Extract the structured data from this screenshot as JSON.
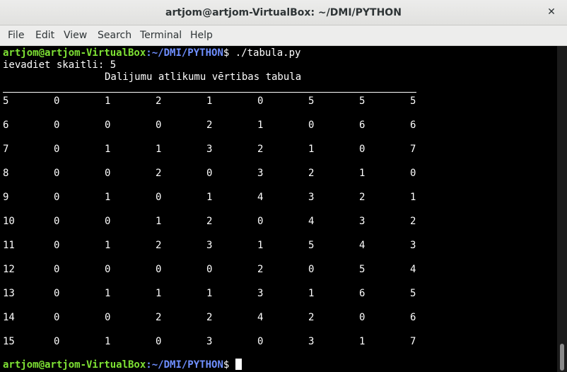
{
  "window": {
    "title": "artjom@artjom-VirtualBox: ~/DMI/PYTHON",
    "close_glyph": "✕"
  },
  "menu": [
    "File",
    "Edit",
    "View",
    "Search",
    "Terminal",
    "Help"
  ],
  "terminal": {
    "prompt_user": "artjom@artjom-VirtualBox",
    "prompt_path": ":~/DMI/PYTHON",
    "prompt_suffix": "$ ",
    "command": "./tabula.py",
    "input_line": "ievadiet skaitli: 5",
    "heading": "Dalijumu atlikumu vērtibas tabula",
    "rows": [
      [
        "5",
        "0",
        "1",
        "2",
        "1",
        "0",
        "5",
        "5",
        "5"
      ],
      [
        "6",
        "0",
        "0",
        "0",
        "2",
        "1",
        "0",
        "6",
        "6"
      ],
      [
        "7",
        "0",
        "1",
        "1",
        "3",
        "2",
        "1",
        "0",
        "7"
      ],
      [
        "8",
        "0",
        "0",
        "2",
        "0",
        "3",
        "2",
        "1",
        "0"
      ],
      [
        "9",
        "0",
        "1",
        "0",
        "1",
        "4",
        "3",
        "2",
        "1"
      ],
      [
        "10",
        "0",
        "0",
        "1",
        "2",
        "0",
        "4",
        "3",
        "2"
      ],
      [
        "11",
        "0",
        "1",
        "2",
        "3",
        "1",
        "5",
        "4",
        "3"
      ],
      [
        "12",
        "0",
        "0",
        "0",
        "0",
        "2",
        "0",
        "5",
        "4"
      ],
      [
        "13",
        "0",
        "1",
        "1",
        "1",
        "3",
        "1",
        "6",
        "5"
      ],
      [
        "14",
        "0",
        "0",
        "2",
        "2",
        "4",
        "2",
        "0",
        "6"
      ],
      [
        "15",
        "0",
        "1",
        "0",
        "3",
        "0",
        "3",
        "1",
        "7"
      ]
    ]
  }
}
